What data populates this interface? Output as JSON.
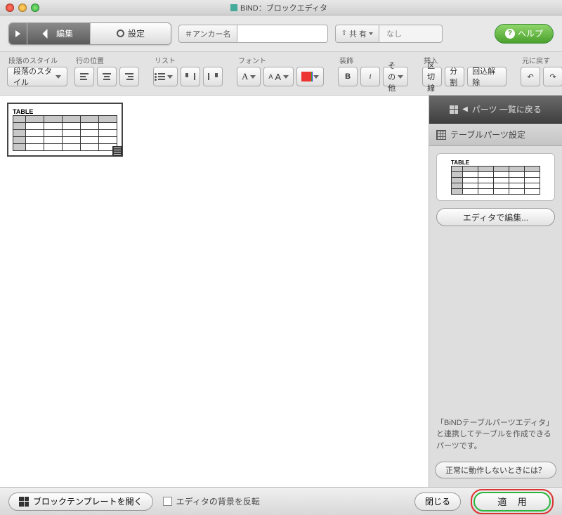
{
  "window": {
    "title": "BiND：ブロックエディタ"
  },
  "topbar": {
    "edit": "編集",
    "settings": "設定",
    "anchor_label": "＃アンカー名",
    "anchor_value": "",
    "share_label": "共 有",
    "share_value": "なし",
    "help": "ヘルプ"
  },
  "fmt": {
    "group_paragraph": "段落のスタイル",
    "paragraph_style": "段落のスタイル",
    "group_align": "行の位置",
    "group_list": "リスト",
    "group_font": "フォント",
    "font_a": "A",
    "font_aa": "AA",
    "group_deco": "装飾",
    "bold": "B",
    "italic": "i",
    "other": "その他",
    "group_insert": "挿入",
    "section_break": "区切線",
    "split": "分 割",
    "unwrap": "回込解除",
    "group_undo": "元に戻す"
  },
  "canvas": {
    "thumb_label": "TABLE"
  },
  "side": {
    "back": "パーツ 一覧に戻る",
    "heading": "テーブルパーツ設定",
    "preview_label": "TABLE",
    "edit_btn": "エディタで編集...",
    "desc": "「BiNDテーブルパーツエディタ」と連携してテーブルを作成できるパーツです。",
    "trouble": "正常に動作しないときには？"
  },
  "bottom": {
    "open_template": "ブロックテンプレートを開く",
    "invert_bg": "エディタの背景を反転",
    "close": "閉じる",
    "apply": "適 用"
  }
}
